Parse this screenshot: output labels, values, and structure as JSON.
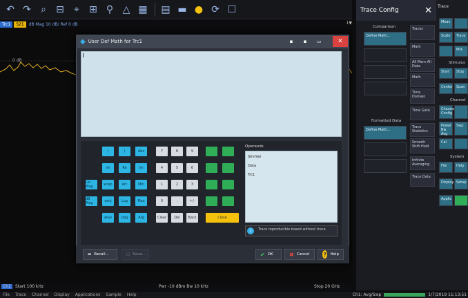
{
  "toolbar": {
    "icons": [
      "undo-icon",
      "redo-icon",
      "zoom-icon",
      "zoom-out-icon",
      "marker-icon",
      "grid-icon",
      "trace-icon",
      "limit-icon",
      "window-icon",
      "settings-icon",
      "help-icon",
      "refresh-icon",
      "display-icon"
    ]
  },
  "strip": {
    "tr1": "Trc1",
    "tr2": "S21",
    "info": "dB Mag 10 dB/ Ref 0 dB",
    "right": "1▼"
  },
  "diagram": {
    "ref_label": "0 dB"
  },
  "bottom": {
    "ch_badge": "Ch1",
    "start": "Start 100 kHz",
    "pwr": "Pwr -10 dBm  Bw 10 kHz",
    "stop": "Stop 20 GHz"
  },
  "menubar": [
    "File",
    "Trace",
    "Channel",
    "Display",
    "Applications",
    "Sample",
    "Help"
  ],
  "statusbar": {
    "ch": "Ch1: Avg/Swp",
    "datetime": "1/7/2019 11:13:51"
  },
  "right_panel": {
    "title": "Trace Config",
    "close": "✕",
    "trace_col_title": "Trace",
    "comparison_label": "Comparison",
    "formatted_data_label": "Formatted Data",
    "buttons": {
      "user_def_math": "Define Math...",
      "traces": "Traces",
      "math": "Math",
      "all_mem_all_data": "All Mem All Data",
      "math2": "Math",
      "time_domain": "Time Domain",
      "time_gate": "Time Gate",
      "user_def_math2": "Define Math...",
      "trace_statistics": "Trace Statistics",
      "smooth_shift_hold": "Smooth Shift Hold",
      "infinite_averaging": "Infinite Averaging",
      "trace_data": "Trace Data",
      "meas": "Meas",
      "scale": "Scale",
      "trace_cfg": "Trace Config",
      "mrk": "Mrk",
      "marker_label": "Stimulus",
      "start": "Start",
      "stop": "Stop",
      "center": "Center",
      "span": "Span",
      "channel_label": "Channel",
      "channel_config": "Channel Config",
      "power_bw_avg": "Power Bw Avg",
      "swp": "Swp",
      "cal": "Cal",
      "system_label": "System",
      "file": "File",
      "help": "Help",
      "display": "Display",
      "setup": "Setup",
      "applic": "Applic",
      "trace_c": "Trace"
    }
  },
  "dialog": {
    "title": "User Def Math for Trc1",
    "operands_label": "Operands",
    "operands": [
      "StimVal",
      "Data",
      "Trc1"
    ],
    "hint": "Trace reproducible based without trace",
    "buttons": {
      "recall": "Recall...",
      "save": "Save...",
      "ok": "OK",
      "cancel": "Cancel",
      "help": "Help"
    },
    "keys": {
      "r1": [
        "(",
        ")",
        "Abs",
        "7",
        "8",
        "9",
        "",
        ""
      ],
      "r2": [
        "jm",
        "Re",
        "Im",
        "4",
        "5",
        "6",
        "",
        ""
      ],
      "r3": [
        "Lin Mag",
        "wrap",
        "Arc",
        "Min",
        "1",
        "2",
        "3",
        "",
        ""
      ],
      "r4": [
        "dB Mag",
        "conj",
        "Log",
        "Max",
        "0",
        ".",
        "+/-",
        "",
        ""
      ],
      "r5": [
        "atan",
        "Deg",
        "Arg",
        "Clear",
        "Del",
        "Back",
        "Close"
      ]
    }
  }
}
